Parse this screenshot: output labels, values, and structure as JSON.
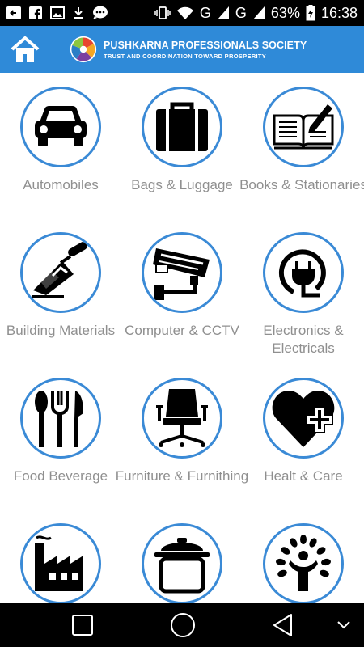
{
  "statusbar": {
    "battery_percent": "63%",
    "time": "16:38",
    "network_1": "G",
    "network_2": "G"
  },
  "header": {
    "title": "PUSHKARNA PROFESSIONALS SOCIETY",
    "subtitle": "TRUST AND COORDINATION TOWARD PROSPERITY"
  },
  "categories": [
    {
      "label": "Automobiles",
      "icon": "car-icon"
    },
    {
      "label": "Bags & Luggage",
      "icon": "suitcase-icon"
    },
    {
      "label": "Books & Stationaries",
      "icon": "book-pen-icon"
    },
    {
      "label": "Building Materials",
      "icon": "trowel-icon"
    },
    {
      "label": "Computer & CCTV",
      "icon": "cctv-camera-icon"
    },
    {
      "label": "Electronics & Electricals",
      "icon": "plug-icon"
    },
    {
      "label": "Food Beverage",
      "icon": "cutlery-icon"
    },
    {
      "label": "Furniture & Furnithing",
      "icon": "office-chair-icon"
    },
    {
      "label": "Healt & Care",
      "icon": "heart-cross-icon"
    },
    {
      "label": "",
      "icon": "factory-icon"
    },
    {
      "label": "",
      "icon": "cooking-pot-icon"
    },
    {
      "label": "",
      "icon": "tree-person-icon"
    }
  ],
  "colors": {
    "header_bg": "#2f8ad8",
    "circle_border": "#3a8ad6",
    "label_text": "#8f8f8f"
  }
}
